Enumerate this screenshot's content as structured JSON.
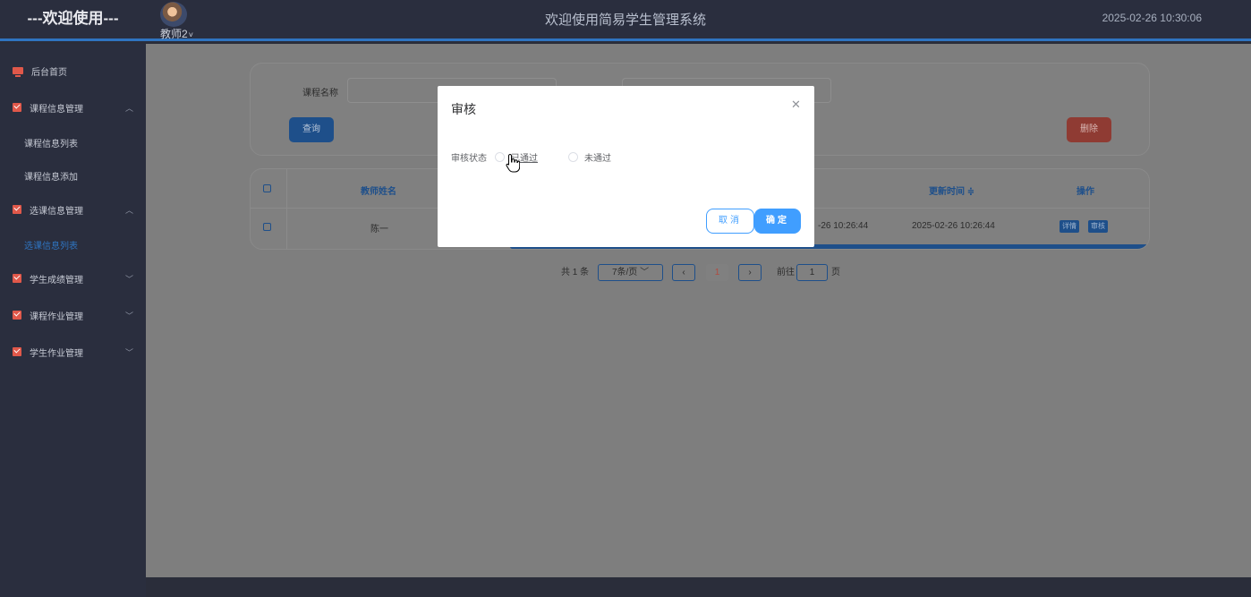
{
  "header": {
    "welcome": "---欢迎使用---",
    "user": "教师2",
    "system_title": "欢迎使用简易学生管理系统",
    "datetime": "2025-02-26 10:30:06"
  },
  "sidebar": {
    "home": "后台首页",
    "groups": [
      {
        "label": "课程信息管理",
        "expanded": true,
        "items": [
          "课程信息列表",
          "课程信息添加"
        ]
      },
      {
        "label": "选课信息管理",
        "expanded": true,
        "items": [
          "选课信息列表"
        ]
      },
      {
        "label": "学生成绩管理",
        "expanded": false
      },
      {
        "label": "课程作业管理",
        "expanded": false
      },
      {
        "label": "学生作业管理",
        "expanded": false
      }
    ]
  },
  "search": {
    "course_name_label": "课程名称",
    "course_name_value": "",
    "query_button": "查询",
    "delete_button": "删除"
  },
  "table": {
    "columns": [
      "教师姓名",
      "更新时间 ≑",
      "操作"
    ],
    "rows": [
      {
        "teacher_name": "陈一",
        "partial_time": "-26 10:26:44",
        "update_time": "2025-02-26 10:26:44",
        "actions": [
          "详情",
          "审核"
        ]
      }
    ]
  },
  "pagination": {
    "total": "共 1 条",
    "page_size": "7条/页",
    "current_page": "1",
    "goto_label": "前往",
    "goto_value": "1",
    "page_suffix": "页"
  },
  "modal": {
    "title": "审核",
    "field_label": "审核状态",
    "options": [
      "已通过",
      "未通过"
    ],
    "selected": null,
    "cancel": "取消",
    "confirm": "确定"
  },
  "colors": {
    "primary": "#409eff",
    "header_bg": "#2a2e3e",
    "accent_bar": "#2f74c0",
    "danger": "#e0584a"
  }
}
